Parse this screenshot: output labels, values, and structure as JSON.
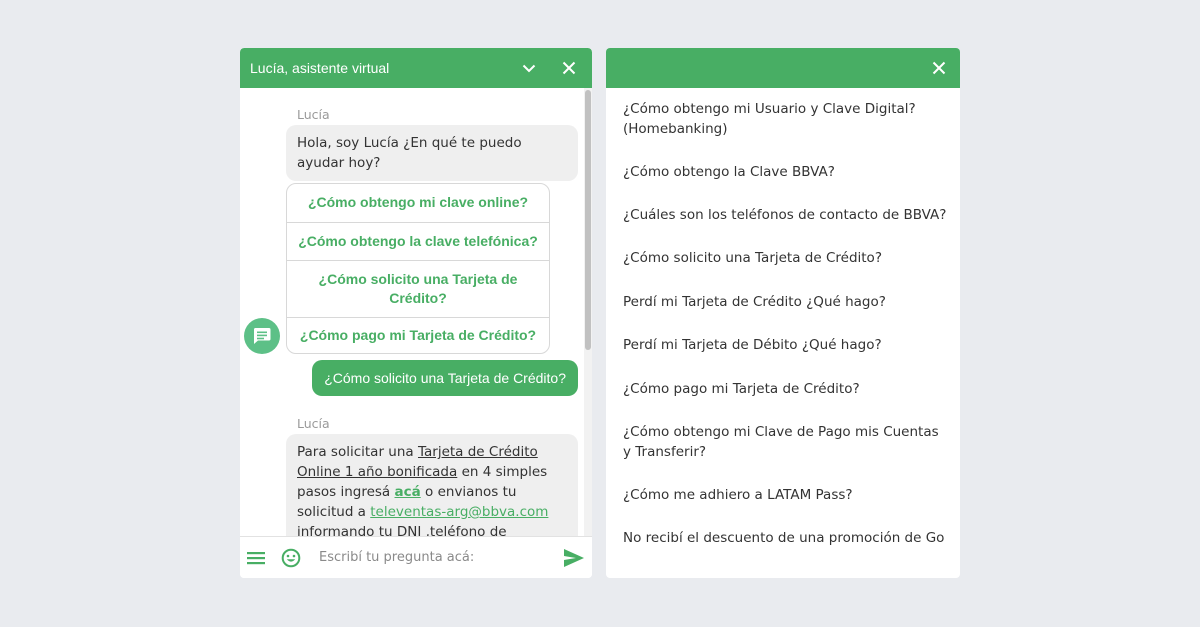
{
  "chat": {
    "title": "Lucía, asistente virtual",
    "bot_name": "Lucía",
    "greeting": "Hola, soy Lucía ¿En qué te puedo ayudar hoy?",
    "quick_replies": [
      "¿Cómo obtengo mi clave online?",
      "¿Cómo obtengo la clave telefónica?",
      "¿Cómo solicito una Tarjeta de Crédito?",
      "¿Cómo pago mi Tarjeta de Crédito?"
    ],
    "user_message": "¿Cómo solicito una Tarjeta de Crédito?",
    "reply": {
      "sender": "Lucía",
      "intro": "Para solicitar una ",
      "link_card": "Tarjeta de Crédito Online 1 año bonificada",
      "mid": " en 4 simples pasos ingresá ",
      "link_here": "acá",
      "mid2": " o envianos tu solicitud a ",
      "email": "televentas-arg@bbva.com",
      "tail": " informando tu DNI ,teléfono de contacto. También podes"
    },
    "input_placeholder": "Escribí tu pregunta acá:"
  },
  "faq": {
    "items": [
      "¿Cómo obtengo mi Usuario y Clave Digital? (Homebanking)",
      "¿Cómo obtengo la Clave BBVA?",
      "¿Cuáles son los teléfonos de contacto de BBVA?",
      "¿Cómo solicito una Tarjeta de Crédito?",
      "Perdí mi Tarjeta de Crédito ¿Qué hago?",
      "Perdí mi Tarjeta de Débito ¿Qué hago?",
      "¿Cómo pago mi Tarjeta de Crédito?",
      "¿Cómo obtengo mi Clave de Pago mis Cuentas y Transferir?",
      "¿Cómo me adhiero a LATAM Pass?",
      "No recibí el descuento de una promoción de Go"
    ]
  },
  "icons": {
    "minimize": "chevron-down-icon",
    "close": "close-icon",
    "menu": "menu-icon",
    "emoji": "smiley-icon",
    "send": "send-icon",
    "bot_avatar": "chat-bubble-icon"
  },
  "colors": {
    "brand_green": "#48ae64",
    "avatar_green": "#5dc087",
    "bot_bubble": "#efefef",
    "background": "#e9ebef"
  }
}
